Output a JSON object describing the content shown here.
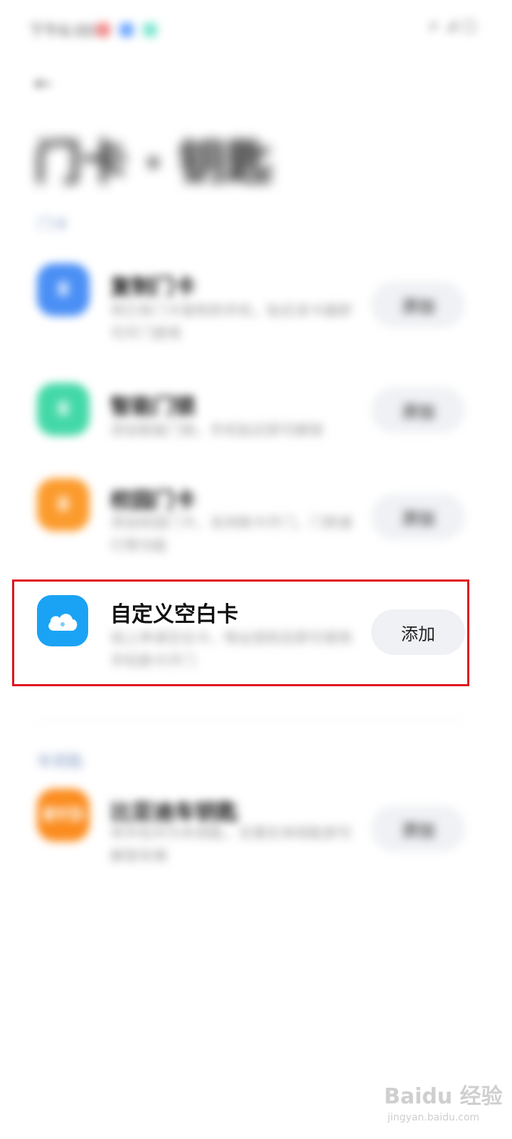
{
  "status_bar": {
    "time": "下午6:00",
    "right": "⚡ .ıl ☐"
  },
  "header": {
    "back": "←",
    "title": "门卡 · 钥匙"
  },
  "sections": {
    "first": "门卡",
    "second": "车钥匙"
  },
  "rows": [
    {
      "name": "复制门卡",
      "desc": "将已有门卡复制到手机，贴近读卡器即可开门使用",
      "action": "添加",
      "color": "#4a8ff5"
    },
    {
      "name": "智能门锁",
      "desc": "添加智能门锁，手机贴近即可解锁",
      "action": "添加",
      "color": "#43d8a7"
    },
    {
      "name": "校园门卡",
      "desc": "添加校园门卡，支持刷卡开门、门禁通行等功能",
      "action": "添加",
      "color": "#fb9b2d"
    },
    {
      "name": "自定义空白卡",
      "desc": "线上申请空白卡，物业授权后即可使用手机刷卡开门",
      "action": "添加",
      "color": "#1aa3f4"
    },
    {
      "name": "比亚迪车钥匙",
      "desc": "将手机作为车钥匙，无需实体钥匙即可解锁车辆",
      "action": "添加",
      "color": "#fb8c1f"
    }
  ],
  "watermark": {
    "text": "Baidu 经验",
    "sub": "jingyan.baidu.com"
  }
}
